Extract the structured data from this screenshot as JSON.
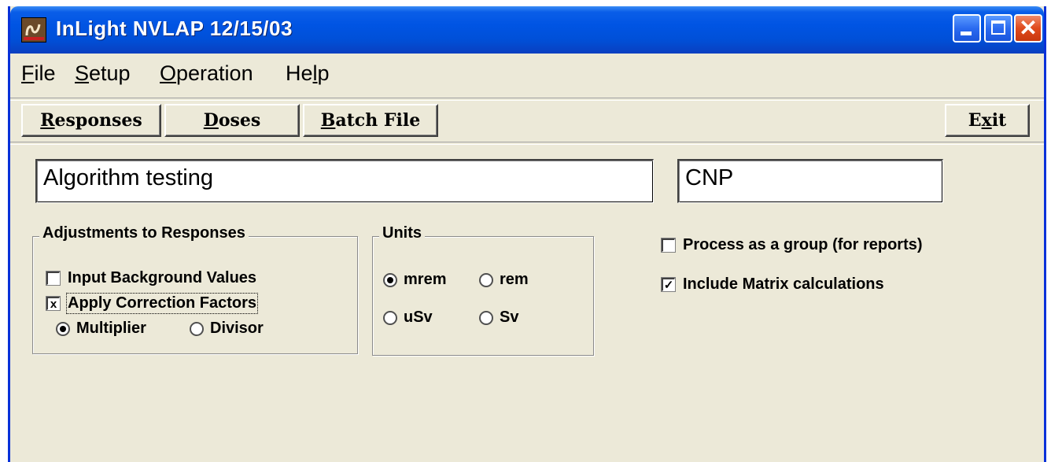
{
  "window": {
    "title": "InLight NVLAP 12/15/03",
    "app_icon": "inlight-logo-icon",
    "controls": {
      "minimize": "minimize-icon",
      "maximize": "maximize-icon",
      "close": "close-icon"
    }
  },
  "menu": {
    "file": {
      "mnemonic": "F",
      "rest": "ile"
    },
    "setup": {
      "mnemonic": "S",
      "rest": "etup"
    },
    "operation": {
      "mnemonic": "O",
      "rest": "peration"
    },
    "help": {
      "pre": "He",
      "mnemonic": "l",
      "rest": "p"
    }
  },
  "toolbar": {
    "responses": {
      "mnemonic": "R",
      "rest": "esponses"
    },
    "doses": {
      "mnemonic": "D",
      "rest": "oses"
    },
    "batch": {
      "mnemonic": "B",
      "rest": "atch File"
    },
    "exit": {
      "pre": "E",
      "mnemonic": "x",
      "rest": "it"
    }
  },
  "fields": {
    "description": "Algorithm testing",
    "code": "CNP"
  },
  "adjustments": {
    "title": "Adjustments to Responses",
    "input_background": {
      "label": "Input Background Values",
      "checked": false
    },
    "apply_correction": {
      "label": "Apply Correction Factors",
      "checked": true,
      "mark": "x"
    },
    "multiplier": {
      "label": "Multiplier",
      "selected": true
    },
    "divisor": {
      "label": "Divisor",
      "selected": false
    }
  },
  "units": {
    "title": "Units",
    "options": [
      {
        "label": "mrem",
        "selected": true
      },
      {
        "label": "rem",
        "selected": false
      },
      {
        "label": "uSv",
        "selected": false
      },
      {
        "label": "Sv",
        "selected": false
      }
    ]
  },
  "options": {
    "process_group": {
      "label": "Process as a group (for reports)",
      "checked": false
    },
    "matrix_calc": {
      "label": "Include Matrix calculations",
      "checked": true,
      "mark": "✓"
    }
  },
  "colors": {
    "titlebar": "#0054e3",
    "window_bg": "#ece9d8",
    "close_button": "#e04a1c"
  }
}
